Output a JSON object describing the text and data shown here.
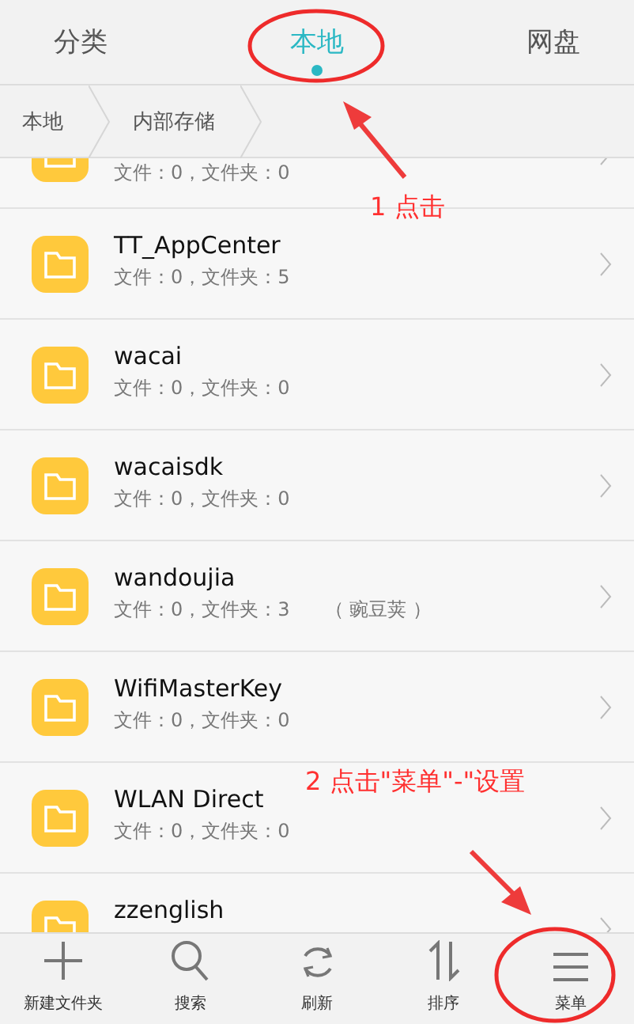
{
  "tabs": [
    {
      "label": "分类",
      "selected": false
    },
    {
      "label": "本地",
      "selected": true
    },
    {
      "label": "网盘",
      "selected": false
    }
  ],
  "breadcrumb": [
    "本地",
    "内部存储"
  ],
  "folders": [
    {
      "info": "文件：0，文件夹：0"
    },
    {
      "name": "TT_AppCenter",
      "info": "文件：0，文件夹：5"
    },
    {
      "name": "wacai",
      "info": "文件：0，文件夹：0"
    },
    {
      "name": "wacaisdk",
      "info": "文件：0，文件夹：0"
    },
    {
      "name": "wandoujia",
      "info": "文件：0，文件夹：3",
      "note": "（ 豌豆荚 ）"
    },
    {
      "name": "WifiMasterKey",
      "info": "文件：0，文件夹：0"
    },
    {
      "name": "WLAN Direct",
      "info": "文件：0，文件夹：0"
    },
    {
      "name": "zzenglish"
    }
  ],
  "toolbar": [
    {
      "kind": "plus",
      "label": "新建文件夹"
    },
    {
      "kind": "search",
      "label": "搜索"
    },
    {
      "kind": "refresh",
      "label": "刷新"
    },
    {
      "kind": "sort",
      "label": "排序"
    },
    {
      "kind": "menu",
      "label": "菜单"
    }
  ],
  "annotations": [
    {
      "text": "1 点击"
    },
    {
      "text": "2 点击\"菜单\"-\"设置"
    }
  ]
}
